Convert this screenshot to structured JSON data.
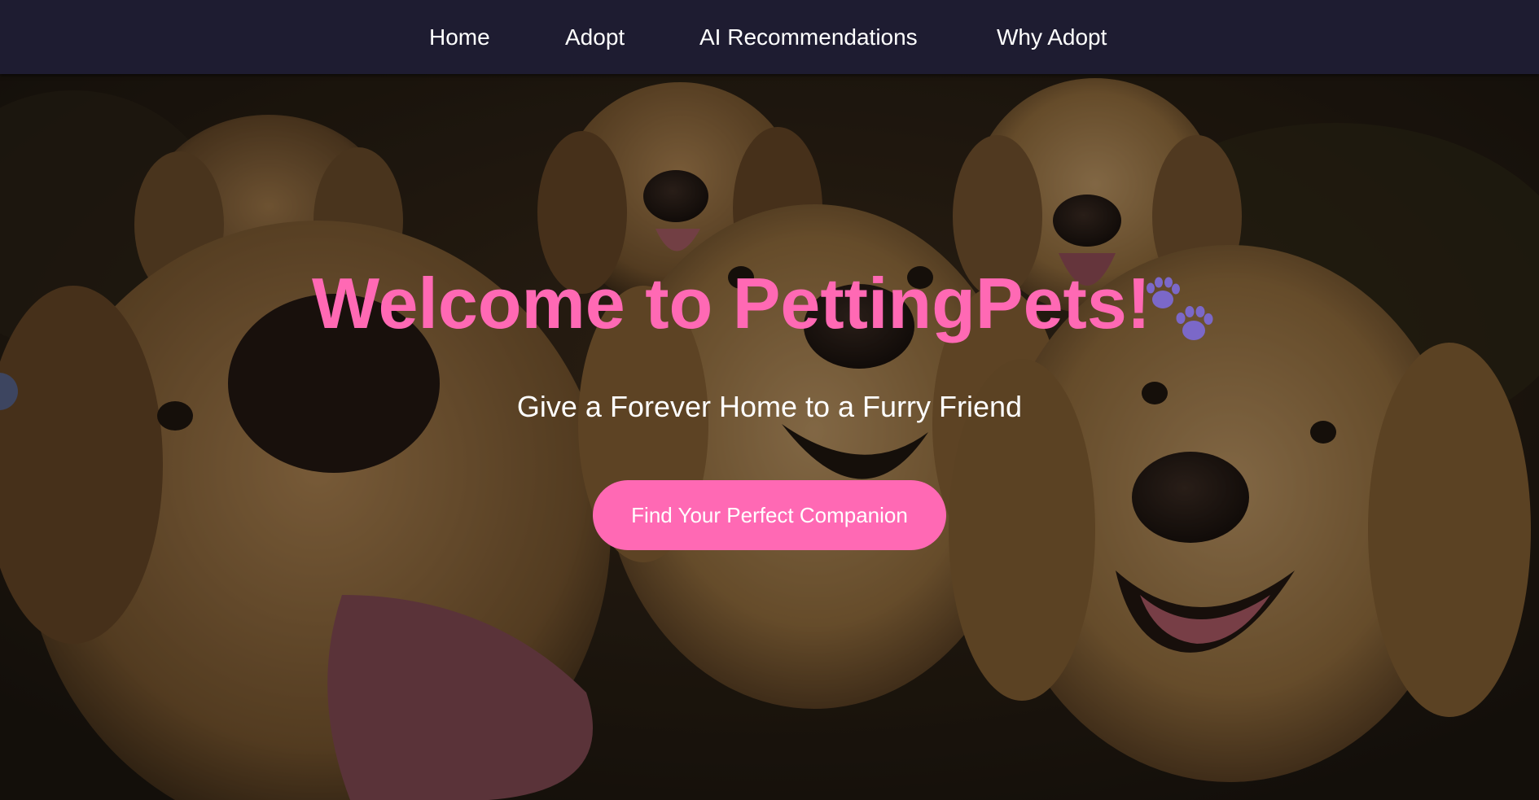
{
  "nav": {
    "items": [
      {
        "label": "Home"
      },
      {
        "label": "Adopt"
      },
      {
        "label": "AI Recommendations"
      },
      {
        "label": "Why Adopt"
      }
    ]
  },
  "hero": {
    "title": "Welcome to PettingPets!",
    "paw_icon": "paw-prints-icon",
    "subtitle": "Give a Forever Home to a Furry Friend",
    "cta_label": "Find Your Perfect Companion",
    "background_image": "golden-retrievers-photo"
  },
  "colors": {
    "nav_bg": "#1e1c31",
    "accent": "#ff69b4",
    "paw": "#7b68c8",
    "text": "#ffffff"
  }
}
